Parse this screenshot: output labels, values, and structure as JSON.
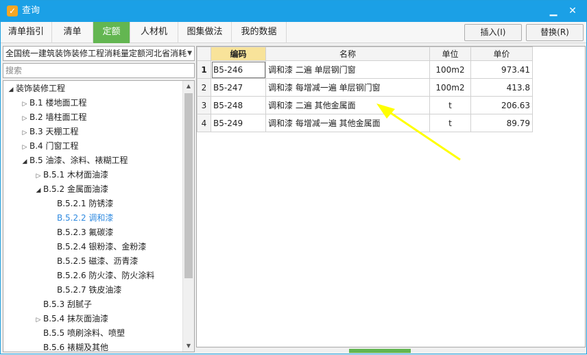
{
  "window": {
    "title": "查询"
  },
  "tabs": [
    {
      "label": "清单指引",
      "active": false
    },
    {
      "label": "清单",
      "active": false
    },
    {
      "label": "定额",
      "active": true
    },
    {
      "label": "人材机",
      "active": false
    },
    {
      "label": "图集做法",
      "active": false
    },
    {
      "label": "我的数据",
      "active": false
    }
  ],
  "actions": {
    "insert_label": "插入(I)",
    "replace_label": "替换(R)"
  },
  "left_panel": {
    "library_selected": "全国统一建筑装饰装修工程消耗量定额河北省消耗",
    "search_placeholder": "搜索",
    "tree": [
      {
        "label": "装饰装修工程",
        "toggle": "open"
      },
      {
        "label": "B.1 楼地面工程",
        "toggle": "closed"
      },
      {
        "label": "B.2 墙柱面工程",
        "toggle": "closed"
      },
      {
        "label": "B.3 天棚工程",
        "toggle": "closed"
      },
      {
        "label": "B.4 门窗工程",
        "toggle": "closed"
      },
      {
        "label": "B.5 油漆、涂料、裱糊工程",
        "toggle": "open"
      },
      {
        "label": "B.5.1 木材面油漆",
        "toggle": "closed"
      },
      {
        "label": "B.5.2 金属面油漆",
        "toggle": "open"
      },
      {
        "label": "B.5.2.1 防锈漆",
        "toggle": "none"
      },
      {
        "label": "B.5.2.2 调和漆",
        "toggle": "none",
        "selected": true
      },
      {
        "label": "B.5.2.3 氟碳漆",
        "toggle": "none"
      },
      {
        "label": "B.5.2.4 银粉漆、金粉漆",
        "toggle": "none"
      },
      {
        "label": "B.5.2.5 磁漆、沥青漆",
        "toggle": "none"
      },
      {
        "label": "B.5.2.6 防火漆、防火涂料",
        "toggle": "none"
      },
      {
        "label": "B.5.2.7 铁皮油漆",
        "toggle": "none"
      },
      {
        "label": "B.5.3 刮腻子",
        "toggle": "none"
      },
      {
        "label": "B.5.4 抹灰面油漆",
        "toggle": "closed"
      },
      {
        "label": "B.5.5 喷刷涂料、喷塑",
        "toggle": "none"
      },
      {
        "label": "B.5.6 裱糊及其他",
        "toggle": "none"
      }
    ]
  },
  "grid": {
    "columns": {
      "code": "编码",
      "name": "名称",
      "unit": "单位",
      "price": "单价"
    },
    "rows": [
      {
        "num": "1",
        "code": "B5-246",
        "name": "调和漆 二遍 单层钢门窗",
        "unit": "100m2",
        "price": "973.41"
      },
      {
        "num": "2",
        "code": "B5-247",
        "name": "调和漆 每增减一遍 单层钢门窗",
        "unit": "100m2",
        "price": "413.8"
      },
      {
        "num": "3",
        "code": "B5-248",
        "name": "调和漆 二遍 其他金属面",
        "unit": "t",
        "price": "206.63"
      },
      {
        "num": "4",
        "code": "B5-249",
        "name": "调和漆 每增减一遍 其他金属面",
        "unit": "t",
        "price": "89.79"
      }
    ]
  },
  "colors": {
    "titlebar": "#1ba0e6",
    "active_tab": "#63b651",
    "sorted_header": "#f8e39a",
    "annotation_arrow": "#ffff00",
    "selected_tree_text": "#2f8ae0"
  }
}
